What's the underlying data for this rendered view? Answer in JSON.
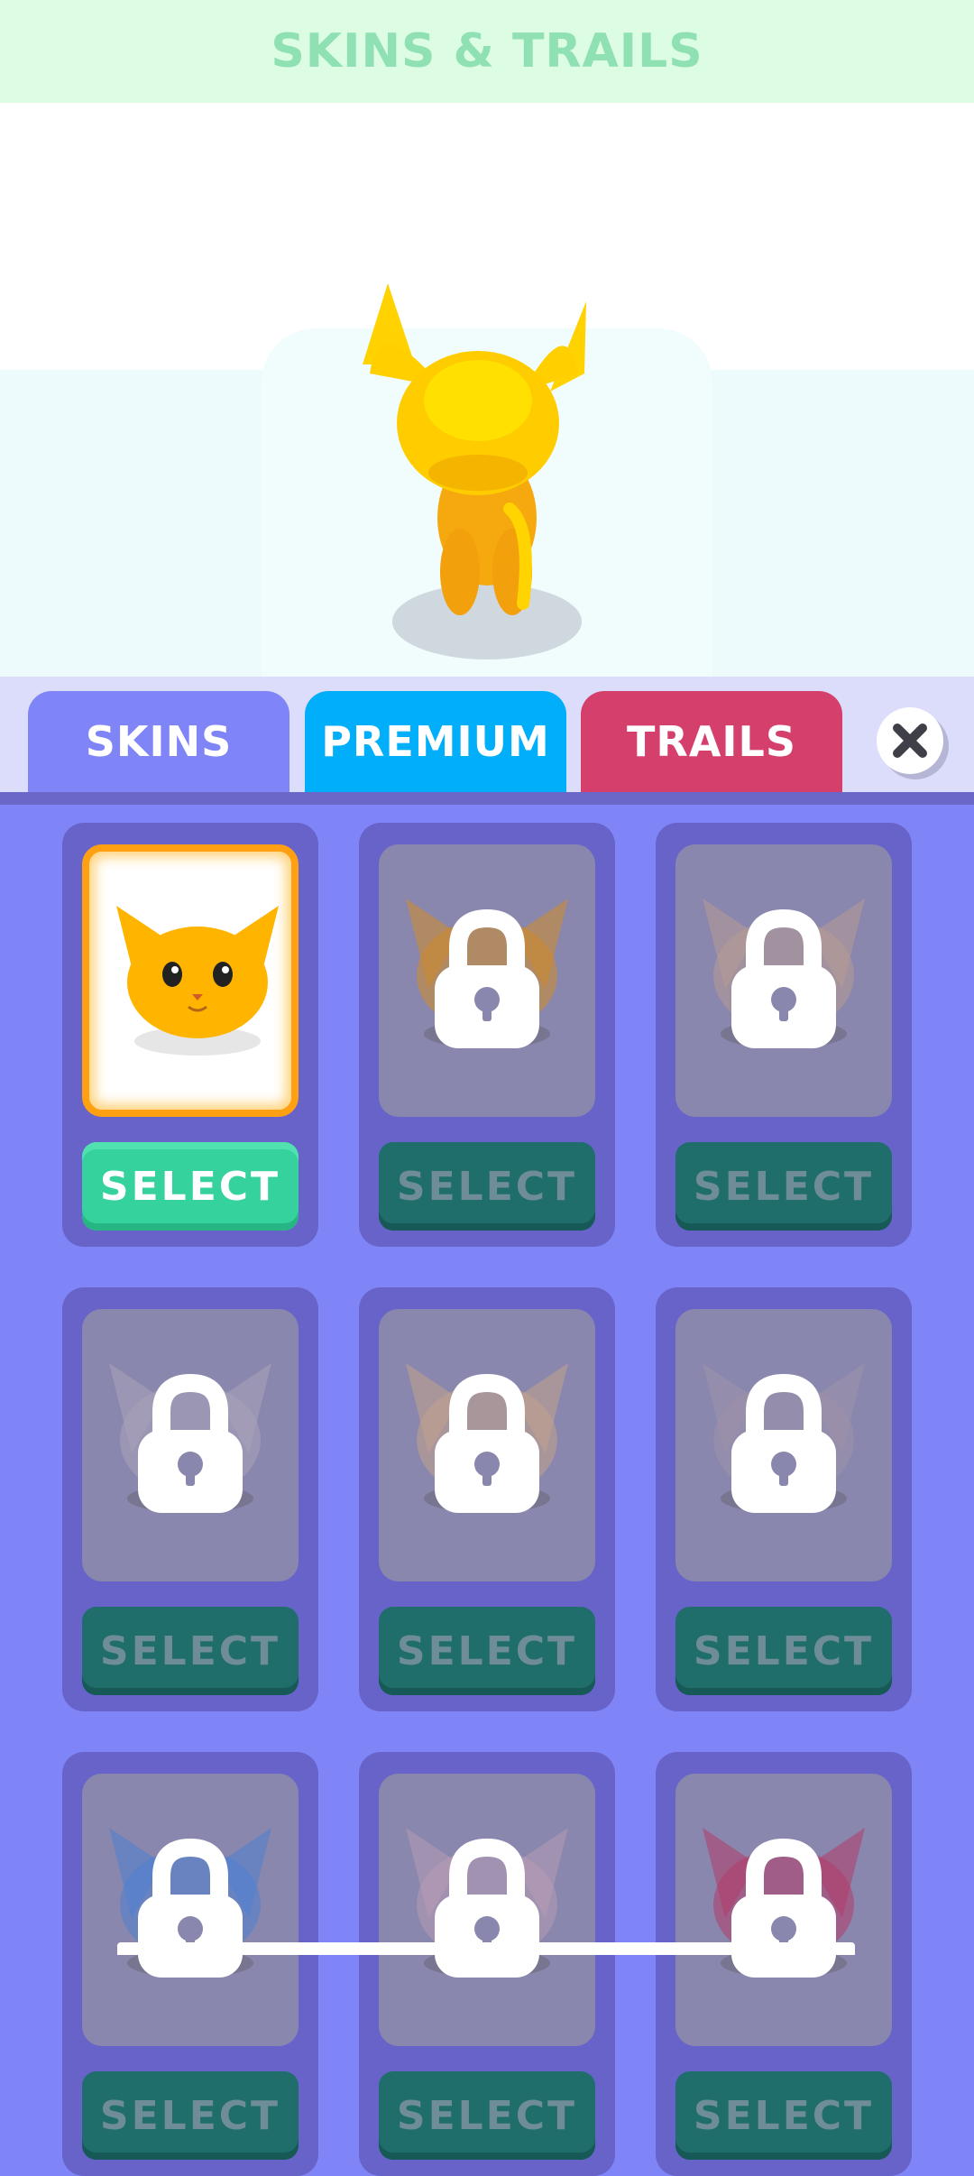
{
  "header": {
    "title": "SKINS & TRAILS"
  },
  "tabs": [
    {
      "label": "SKINS",
      "color": "#7f84f7"
    },
    {
      "label": "PREMIUM",
      "color": "#01aef9"
    },
    {
      "label": "TRAILS",
      "color": "#d53f6c"
    }
  ],
  "close_icon": "close-icon",
  "skins": [
    {
      "name": "orange-cat",
      "color": "#ffb400",
      "locked": false,
      "selected": true,
      "button": "SELECT"
    },
    {
      "name": "tiger-cat",
      "color": "#d08a2a",
      "locked": true,
      "button": "SELECT"
    },
    {
      "name": "siamese-cat",
      "color": "#b79b93",
      "locked": true,
      "button": "SELECT"
    },
    {
      "name": "patched-cat",
      "color": "#a9a3b8",
      "locked": true,
      "button": "SELECT"
    },
    {
      "name": "calico-cat",
      "color": "#c3a38d",
      "locked": true,
      "button": "SELECT"
    },
    {
      "name": "grey-cat",
      "color": "#9d92a9",
      "locked": true,
      "button": "SELECT"
    },
    {
      "name": "blue-cat",
      "color": "#4f7fd0",
      "locked": true,
      "button": "SELECT"
    },
    {
      "name": "pink-cat",
      "color": "#b79ab5",
      "locked": true,
      "button": "SELECT"
    },
    {
      "name": "red-cat",
      "color": "#b23a6a",
      "locked": true,
      "button": "SELECT"
    }
  ]
}
